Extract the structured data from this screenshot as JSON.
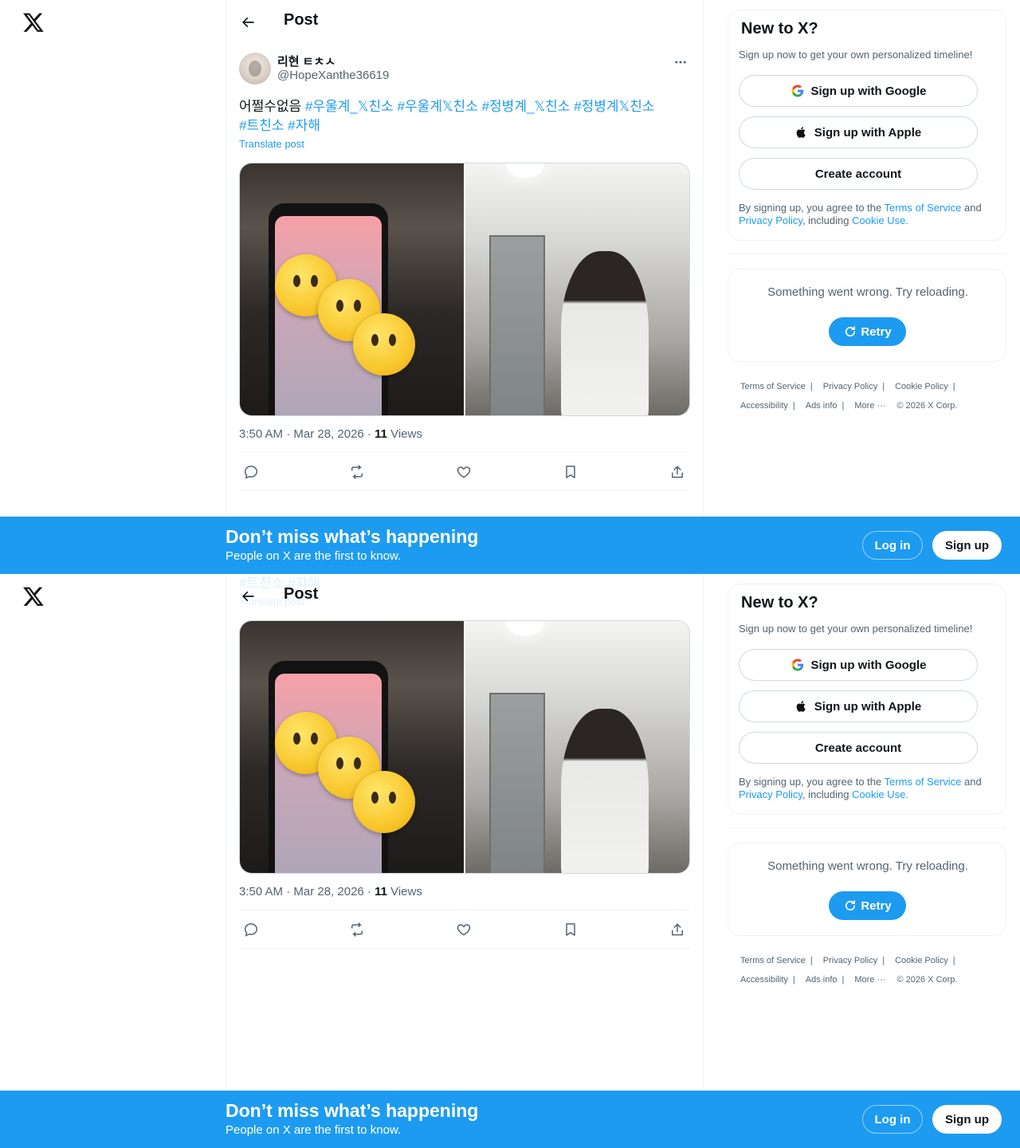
{
  "header": {
    "title": "Post"
  },
  "post": {
    "display_name": "리현 ㅌㅊㅅ",
    "handle": "@HopeXanthe36619",
    "text_prefix": "어쩔수없음 ",
    "hashtags": [
      "#우울계_𝕏친소",
      "#우울계𝕏친소",
      "#정병계_𝕏친소",
      "#정병계𝕏친소",
      "#트친소",
      "#자해"
    ],
    "translate": "Translate post",
    "time": "3:50 AM · Mar 28, 2026 · ",
    "views_count": "11",
    "views_label": " Views"
  },
  "signup": {
    "title": "New to X?",
    "subtitle": "Sign up now to get your own personalized timeline!",
    "google": "Sign up with Google",
    "apple": "Sign up with Apple",
    "create": "Create account",
    "terms_prefix": "By signing up, you agree to the ",
    "terms_link": "Terms of Service",
    "and": " and ",
    "privacy_link": "Privacy Policy",
    "including": ", including ",
    "cookie_link": "Cookie Use."
  },
  "error": {
    "text": "Something went wrong. Try reloading.",
    "retry": "Retry"
  },
  "footer": {
    "links_row1": [
      "Terms of Service",
      "Privacy Policy",
      "Cookie Policy"
    ],
    "links_row2": [
      "Accessibility",
      "Ads info",
      "More ···"
    ],
    "copyright": "© 2026 X Corp."
  },
  "banner": {
    "title": "Don’t miss what’s happening",
    "subtitle": "People on X are the first to know.",
    "login": "Log in",
    "signup": "Sign up"
  },
  "colors": {
    "accent": "#1d9bf0",
    "text": "#0f1419",
    "muted": "#536471"
  },
  "icons": [
    "x-logo-icon",
    "back-arrow-icon",
    "more-icon",
    "reply-icon",
    "repost-icon",
    "like-icon",
    "bookmark-icon",
    "share-icon",
    "google-icon",
    "apple-icon",
    "refresh-icon"
  ]
}
